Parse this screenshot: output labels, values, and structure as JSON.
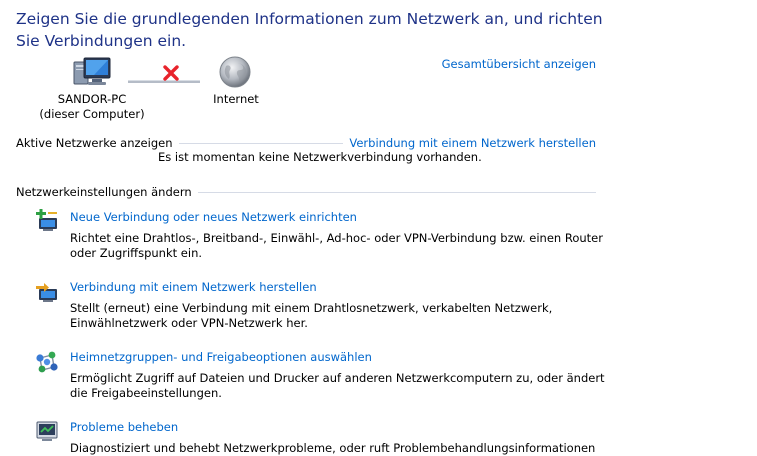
{
  "header": {
    "title": "Zeigen Sie die grundlegenden Informationen zum Netzwerk an, und richten Sie Verbindungen ein."
  },
  "network_map": {
    "computer_name": "SANDOR-PC",
    "computer_sub": "(dieser Computer)",
    "internet_label": "Internet",
    "overview_link": "Gesamtübersicht anzeigen"
  },
  "active_networks": {
    "heading": "Aktive Netzwerke anzeigen",
    "connect_link": "Verbindung mit einem Netzwerk herstellen",
    "status": "Es ist momentan keine Netzwerkverbindung vorhanden."
  },
  "settings": {
    "heading": "Netzwerkeinstellungen ändern",
    "tasks": [
      {
        "icon": "new-connection-icon",
        "label": "Neue Verbindung oder neues Netzwerk einrichten",
        "description": "Richtet eine Drahtlos-, Breitband-, Einwähl-, Ad-hoc- oder VPN-Verbindung bzw. einen Router oder Zugriffspunkt ein."
      },
      {
        "icon": "connect-network-icon",
        "label": "Verbindung mit einem Netzwerk herstellen",
        "description": "Stellt (erneut) eine Verbindung mit einem Drahtlosnetzwerk, verkabelten Netzwerk, Einwählnetzwerk oder VPN-Netzwerk her."
      },
      {
        "icon": "homegroup-icon",
        "label": "Heimnetzgruppen- und Freigabeoptionen auswählen",
        "description": "Ermöglicht Zugriff auf Dateien und Drucker auf anderen Netzwerkcomputern zu, oder ändert die Freigabeeinstellungen."
      },
      {
        "icon": "troubleshoot-icon",
        "label": "Probleme beheben",
        "description": "Diagnostiziert und behebt Netzwerkprobleme, oder ruft Problembehandlungsinformationen ab."
      }
    ]
  },
  "colors": {
    "title": "#1e3287",
    "link": "#0066cc",
    "divider": "#d6dbe6",
    "error": "#e8232b"
  }
}
